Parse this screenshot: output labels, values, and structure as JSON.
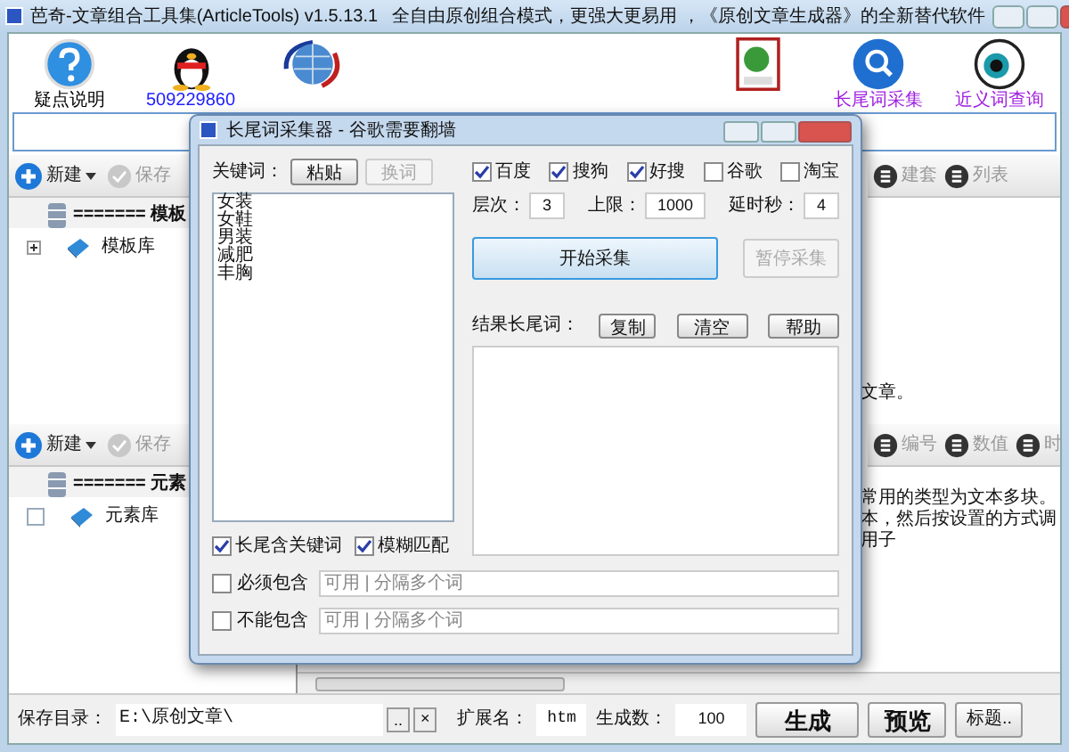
{
  "window": {
    "title": "芭奇-文章组合工具集(ArticleTools) v1.5.13.1",
    "slogan": "全自由原创组合模式，更强大更易用 ，《原创文章生成器》的全新替代软件"
  },
  "toolbar": [
    {
      "label": "疑点说明",
      "kind": "help",
      "color": "#000000"
    },
    {
      "label": "509229860",
      "kind": "qq",
      "color": "#2020ff"
    },
    {
      "kind": "globe"
    },
    {
      "kind": "spacer"
    },
    {
      "kind": "html"
    },
    {
      "label": "长尾词采集",
      "kind": "search",
      "color": "#a020e0"
    },
    {
      "label": "近义词查询",
      "kind": "eye",
      "color": "#a020e0"
    }
  ],
  "left_panels": [
    {
      "tools": [
        "新建",
        "保存"
      ],
      "header": "======= 模板",
      "item": "模板库",
      "kind": "expander",
      "expanded": false
    },
    {
      "tools": [
        "新建",
        "保存"
      ],
      "header": "======= 元素",
      "item": "元素库",
      "kind": "checkbox",
      "checked": false
    }
  ],
  "right_top": {
    "tools": [
      "建套",
      "列表"
    ],
    "text": "文章。"
  },
  "right_bottom": {
    "tools": [
      "编号",
      "数值",
      "时"
    ],
    "lines": [
      "常用的类型为文本多块。",
      "本，然后按设置的方式调用子"
    ]
  },
  "bottom_bar": {
    "dir_label": "保存目录：",
    "dir_value": "E:\\原创文章\\",
    "browse": "..",
    "clear": "×",
    "ext_label": "扩展名：",
    "ext_value": "htm",
    "count_label": "生成数：",
    "count_value": "100",
    "generate": "生成",
    "preview": "预览",
    "title_btn": "标题.."
  },
  "dialog": {
    "title": "长尾词采集器 - 谷歌需要翻墙",
    "keyword_label": "关键词：",
    "paste": {
      "label": "粘贴",
      "disabled": false
    },
    "swap": {
      "label": "换词",
      "disabled": true
    },
    "keywords": [
      "女装",
      "女鞋",
      "男装",
      "减肥",
      "丰胸"
    ],
    "options": [
      {
        "label": "长尾含关键词",
        "checked": true
      },
      {
        "label": "模糊匹配",
        "checked": true
      }
    ],
    "engines": [
      {
        "label": "百度",
        "checked": true
      },
      {
        "label": "搜狗",
        "checked": true
      },
      {
        "label": "好搜",
        "checked": true
      },
      {
        "label": "谷歌",
        "checked": false
      },
      {
        "label": "淘宝",
        "checked": false
      }
    ],
    "params": [
      {
        "label": "层次：",
        "value": "3"
      },
      {
        "label": "上限：",
        "value": "1000"
      },
      {
        "label": "延时秒：",
        "value": "4"
      }
    ],
    "start": {
      "label": "开始采集",
      "disabled": false
    },
    "pause": {
      "label": "暂停采集",
      "disabled": true
    },
    "result_label": "结果长尾词：",
    "result_buttons": [
      "复制",
      "清空",
      "帮助"
    ],
    "filters": [
      {
        "label": "必须包含",
        "checked": false,
        "placeholder": "可用 | 分隔多个词"
      },
      {
        "label": "不能包含",
        "checked": false,
        "placeholder": "可用 | 分隔多个词"
      }
    ]
  }
}
